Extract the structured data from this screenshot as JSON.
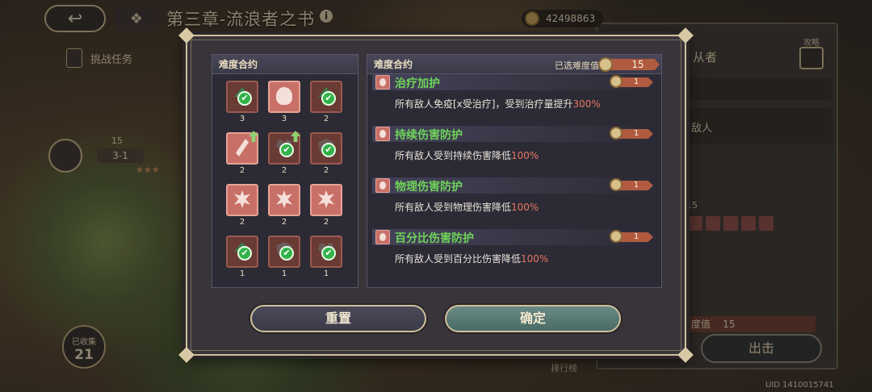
{
  "topbar": {
    "back_icon": "back-arrow-icon",
    "chapter_title": "第三章-流浪者之书",
    "currency": [
      {
        "icon": "coin-icon",
        "value": "42498863"
      }
    ]
  },
  "map": {
    "task_label": "挑战任务",
    "stage": {
      "level": "15",
      "name": "3-1",
      "stars": "★★★"
    },
    "collected_label": "已收集",
    "collected_count": "21",
    "rank_label": "排行榜",
    "uid": "UID 1410015741"
  },
  "side_panel": {
    "title": "从者",
    "guide_label": "攻略",
    "enemy_text": "敌人",
    "difficulty_value": "15",
    "difficulty_bar_label": "度值",
    "difficulty_bar_value": "15",
    "go_button": "出击"
  },
  "modal": {
    "left_title": "难度合约",
    "right_title": "难度合约",
    "selected_label": "已选难度值",
    "selected_value": "15",
    "tiles": [
      {
        "symbol": "arrow",
        "active": false,
        "checked": true,
        "upgrade": false,
        "count": "3"
      },
      {
        "symbol": "person",
        "active": true,
        "checked": false,
        "upgrade": false,
        "count": "3"
      },
      {
        "symbol": "arrow",
        "active": false,
        "checked": true,
        "upgrade": false,
        "count": "2"
      },
      {
        "symbol": "slash",
        "active": true,
        "checked": false,
        "upgrade": true,
        "count": "2"
      },
      {
        "symbol": "heart",
        "active": false,
        "checked": true,
        "upgrade": true,
        "count": "2"
      },
      {
        "symbol": "shield",
        "active": false,
        "checked": true,
        "upgrade": false,
        "count": "2"
      },
      {
        "symbol": "burst",
        "active": true,
        "checked": false,
        "upgrade": false,
        "count": "2"
      },
      {
        "symbol": "burst",
        "active": true,
        "checked": false,
        "upgrade": false,
        "count": "2"
      },
      {
        "symbol": "burst",
        "active": true,
        "checked": false,
        "upgrade": false,
        "count": "2"
      },
      {
        "symbol": "arrow",
        "active": false,
        "checked": true,
        "upgrade": false,
        "count": "1"
      },
      {
        "symbol": "shield",
        "active": false,
        "checked": true,
        "upgrade": false,
        "count": "1"
      },
      {
        "symbol": "heart",
        "active": false,
        "checked": true,
        "upgrade": false,
        "count": "1"
      }
    ],
    "contracts": [
      {
        "title": "治疗加护",
        "points": "1",
        "desc": "所有敌人免疫[x受治疗]，受到治疗量提升",
        "highlight": "300%"
      },
      {
        "title": "持续伤害防护",
        "points": "1",
        "desc": "所有敌人受到持续伤害降低",
        "highlight": "100%"
      },
      {
        "title": "物理伤害防护",
        "points": "1",
        "desc": "所有敌人受到物理伤害降低",
        "highlight": "100%"
      },
      {
        "title": "百分比伤害防护",
        "points": "1",
        "desc": "所有敌人受到百分比伤害降低",
        "highlight": "100%"
      }
    ],
    "reset_button": "重置",
    "confirm_button": "确定"
  }
}
